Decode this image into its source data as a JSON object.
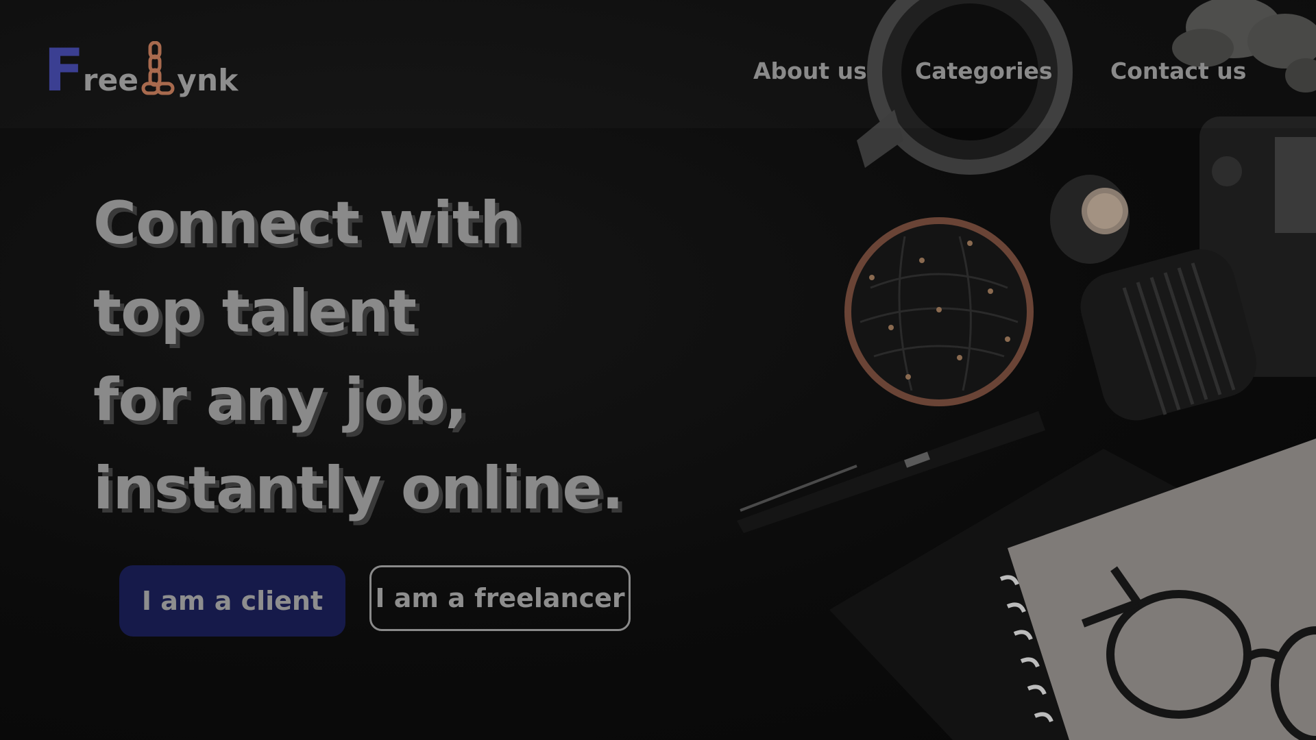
{
  "brand": {
    "logo_first_letter": "F",
    "logo_part1": "ree",
    "logo_part2": "ynk",
    "logo_first_letter_color": "#3b3f92",
    "chain_icon_color": "#a86a4e"
  },
  "nav": {
    "items": [
      {
        "label": "About us"
      },
      {
        "label": "Categories"
      },
      {
        "label": "Contact us"
      }
    ]
  },
  "hero": {
    "headline_lines": [
      "Connect with",
      "top talent",
      "for any job,",
      "instantly online."
    ],
    "primary_button": "I am a client",
    "secondary_button": "I am a freelancer",
    "primary_button_color": "#161a4a"
  }
}
